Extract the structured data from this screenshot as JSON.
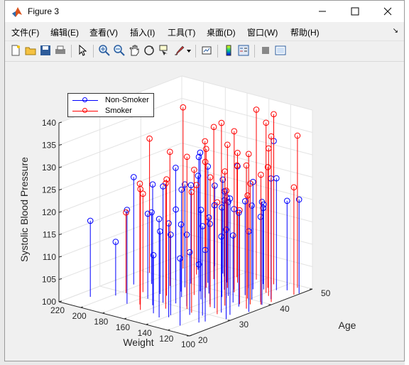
{
  "window": {
    "title": "Figure 3"
  },
  "menu": {
    "items": [
      "文件(F)",
      "编辑(E)",
      "查看(V)",
      "插入(I)",
      "工具(T)",
      "桌面(D)",
      "窗口(W)",
      "帮助(H)"
    ]
  },
  "toolbar": {
    "icons": [
      "new-figure-icon",
      "open-file-icon",
      "save-icon",
      "print-icon",
      "pointer-icon",
      "zoom-in-icon",
      "zoom-out-icon",
      "pan-icon",
      "rotate-3d-icon",
      "data-cursor-icon",
      "brush-icon",
      "brush-dropdown-icon",
      "link-plot-icon",
      "colorbar-icon",
      "legend-icon",
      "hide-plot-tools-icon",
      "show-plot-tools-icon"
    ]
  },
  "colors": {
    "nonsmoker": "#0000ff",
    "smoker": "#ff0000"
  },
  "chart_data": {
    "type": "stem3",
    "ylabel_z": "Systolic Blood Pressure",
    "xlabel": "Weight",
    "ylabel": "Age",
    "zlim": [
      100,
      140
    ],
    "zticks": [
      100,
      105,
      110,
      115,
      120,
      125,
      130,
      135,
      140
    ],
    "xlim": [
      100,
      220
    ],
    "xticks": [
      100,
      120,
      140,
      160,
      180,
      200,
      220
    ],
    "ylim": [
      20,
      50
    ],
    "yticks": [
      20,
      30,
      40,
      50
    ],
    "grid": true,
    "legend_position": "top-left",
    "series": [
      {
        "name": "Non-Smoker",
        "color": "#0000ff",
        "marker": "circle",
        "points": [
          [
            210,
            25,
            117
          ],
          [
            204,
            34,
            124
          ],
          [
            195,
            36,
            116
          ],
          [
            188,
            40,
            125
          ],
          [
            178,
            43,
            127
          ],
          [
            174,
            40,
            122
          ],
          [
            171,
            47,
            121
          ],
          [
            166,
            42,
            126
          ],
          [
            162,
            30,
            126
          ],
          [
            158,
            38,
            131
          ],
          [
            150,
            45,
            126
          ],
          [
            147,
            41,
            122
          ],
          [
            143,
            24,
            122
          ],
          [
            140,
            26,
            118
          ],
          [
            138,
            38,
            120
          ],
          [
            134,
            34,
            118
          ],
          [
            128,
            48,
            132
          ],
          [
            126,
            33,
            123
          ],
          [
            122,
            29,
            120
          ],
          [
            118,
            46,
            125
          ],
          [
            115,
            36,
            121
          ],
          [
            112,
            27,
            116
          ],
          [
            108,
            42,
            127
          ],
          [
            105,
            39,
            123
          ],
          [
            101,
            47,
            121
          ],
          [
            198,
            28,
            112
          ],
          [
            176,
            33,
            114
          ],
          [
            168,
            36,
            115
          ],
          [
            160,
            34,
            124
          ],
          [
            152,
            25,
            113
          ],
          [
            144,
            31,
            116
          ],
          [
            136,
            39,
            121
          ],
          [
            130,
            28,
            114
          ],
          [
            124,
            37,
            115
          ],
          [
            116,
            32,
            117
          ],
          [
            110,
            40,
            119
          ],
          [
            104,
            30,
            120
          ],
          [
            180,
            26,
            121
          ],
          [
            156,
            44,
            119
          ],
          [
            132,
            44,
            124
          ],
          [
            190,
            46,
            121
          ],
          [
            146,
            35,
            120
          ],
          [
            120,
            23,
            115
          ],
          [
            172,
            38,
            123
          ],
          [
            164,
            28,
            127
          ],
          [
            142,
            42,
            118
          ],
          [
            126,
            45,
            119
          ],
          [
            114,
            26,
            113
          ],
          [
            102,
            35,
            118
          ],
          [
            154,
            31,
            121
          ],
          [
            186,
            49,
            118
          ],
          [
            134,
            47,
            117
          ],
          [
            118,
            40,
            121
          ],
          [
            108,
            32,
            126
          ],
          [
            176,
            30,
            119
          ],
          [
            150,
            38,
            117
          ],
          [
            138,
            25,
            121
          ],
          [
            166,
            46,
            117
          ],
          [
            128,
            41,
            121
          ],
          [
            112,
            47,
            120
          ]
        ]
      },
      {
        "name": "Smoker",
        "color": "#ff0000",
        "marker": "circle",
        "points": [
          [
            212,
            40,
            130
          ],
          [
            200,
            45,
            136
          ],
          [
            188,
            32,
            122
          ],
          [
            182,
            37,
            130
          ],
          [
            176,
            48,
            133
          ],
          [
            170,
            33,
            126
          ],
          [
            168,
            44,
            134
          ],
          [
            160,
            40,
            131
          ],
          [
            156,
            36,
            128
          ],
          [
            150,
            45,
            129
          ],
          [
            148,
            42,
            132
          ],
          [
            144,
            48,
            138
          ],
          [
            142,
            35,
            131
          ],
          [
            140,
            30,
            134
          ],
          [
            136,
            44,
            130
          ],
          [
            134,
            38,
            124
          ],
          [
            130,
            33,
            129
          ],
          [
            126,
            46,
            127
          ],
          [
            122,
            40,
            123
          ],
          [
            118,
            37,
            121
          ],
          [
            114,
            43,
            133
          ],
          [
            110,
            49,
            134
          ],
          [
            106,
            39,
            129
          ],
          [
            102,
            46,
            124
          ],
          [
            196,
            30,
            118
          ],
          [
            172,
            27,
            127
          ],
          [
            164,
            25,
            127
          ],
          [
            152,
            28,
            128
          ],
          [
            146,
            36,
            135
          ],
          [
            138,
            41,
            136
          ],
          [
            132,
            29,
            127
          ],
          [
            124,
            35,
            130
          ],
          [
            116,
            31,
            125
          ],
          [
            108,
            36,
            132
          ],
          [
            104,
            41,
            137
          ],
          [
            184,
            44,
            120
          ],
          [
            158,
            47,
            125
          ],
          [
            128,
            48,
            138
          ],
          [
            120,
            44,
            138
          ],
          [
            112,
            38,
            127
          ]
        ]
      }
    ]
  }
}
